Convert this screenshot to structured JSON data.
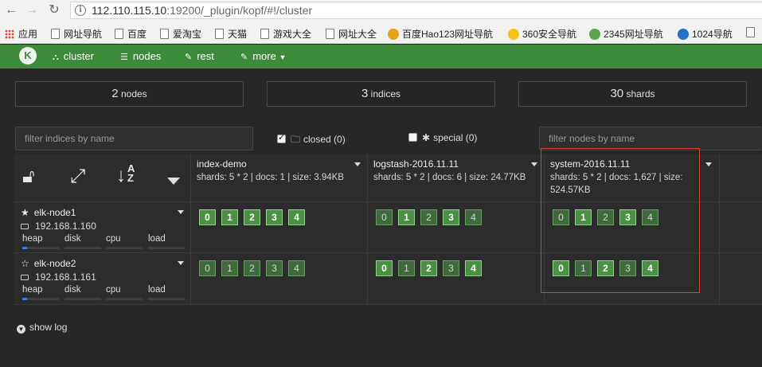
{
  "browser": {
    "url_host": "112.110.115.10",
    "url_rest": ":19200/_plugin/kopf/#!/cluster",
    "bookmarks": [
      "应用",
      "网址导航",
      "百度",
      "爱淘宝",
      "天猫",
      "游戏大全",
      "网址大全",
      "百度Hao123网址导航",
      "360安全导航",
      "2345网址导航",
      "1024导航"
    ]
  },
  "navbar": {
    "logo": "K",
    "items": [
      "cluster",
      "nodes",
      "rest",
      "more"
    ]
  },
  "stats": {
    "nodes": {
      "value": "2",
      "label": "nodes"
    },
    "indices": {
      "value": "3",
      "label": "indices"
    },
    "shards": {
      "value": "30",
      "label": "shards"
    }
  },
  "filters": {
    "indices_placeholder": "filter indices by name",
    "nodes_placeholder": "filter nodes by name",
    "closed_label": "closed (0)",
    "closed_checked": true,
    "special_label": "special (0)",
    "special_checked": false
  },
  "indices": [
    {
      "name": "index-demo",
      "meta": "shards: 5 * 2 | docs: 1 | size: 3.94KB"
    },
    {
      "name": "logstash-2016.11.11",
      "meta": "shards: 5 * 2 | docs: 6 | size: 24.77KB"
    },
    {
      "name": "system-2016.11.11",
      "meta": "shards: 5 * 2 | docs: 1,627 | size: 524.57KB"
    }
  ],
  "nodes": [
    {
      "name": "elk-node1",
      "ip": "192.168.1.160",
      "master": true,
      "metrics": [
        "heap",
        "disk",
        "cpu",
        "load"
      ]
    },
    {
      "name": "elk-node2",
      "ip": "192.168.1.161",
      "master": false,
      "metrics": [
        "heap",
        "disk",
        "cpu",
        "load"
      ]
    }
  ],
  "shards": {
    "node1": [
      [
        {
          "n": "0",
          "p": true
        },
        {
          "n": "1",
          "p": true
        },
        {
          "n": "2",
          "p": true
        },
        {
          "n": "3",
          "p": true
        },
        {
          "n": "4",
          "p": true
        }
      ],
      [
        {
          "n": "0",
          "p": false
        },
        {
          "n": "1",
          "p": true
        },
        {
          "n": "2",
          "p": false
        },
        {
          "n": "3",
          "p": true
        },
        {
          "n": "4",
          "p": false
        }
      ],
      [
        {
          "n": "0",
          "p": false
        },
        {
          "n": "1",
          "p": true
        },
        {
          "n": "2",
          "p": false
        },
        {
          "n": "3",
          "p": true
        },
        {
          "n": "4",
          "p": false
        }
      ]
    ],
    "node2": [
      [
        {
          "n": "0",
          "p": false
        },
        {
          "n": "1",
          "p": false
        },
        {
          "n": "2",
          "p": false
        },
        {
          "n": "3",
          "p": false
        },
        {
          "n": "4",
          "p": false
        }
      ],
      [
        {
          "n": "0",
          "p": true
        },
        {
          "n": "1",
          "p": false
        },
        {
          "n": "2",
          "p": true
        },
        {
          "n": "3",
          "p": false
        },
        {
          "n": "4",
          "p": true
        }
      ],
      [
        {
          "n": "0",
          "p": true
        },
        {
          "n": "1",
          "p": false
        },
        {
          "n": "2",
          "p": true
        },
        {
          "n": "3",
          "p": false
        },
        {
          "n": "4",
          "p": true
        }
      ]
    ]
  },
  "show_log": "show log",
  "colors": {
    "navbar": "#3d8a3a",
    "primary_shard": "#4a9144",
    "replica_shard": "#3f6a3c",
    "highlight": "#d9443b"
  }
}
